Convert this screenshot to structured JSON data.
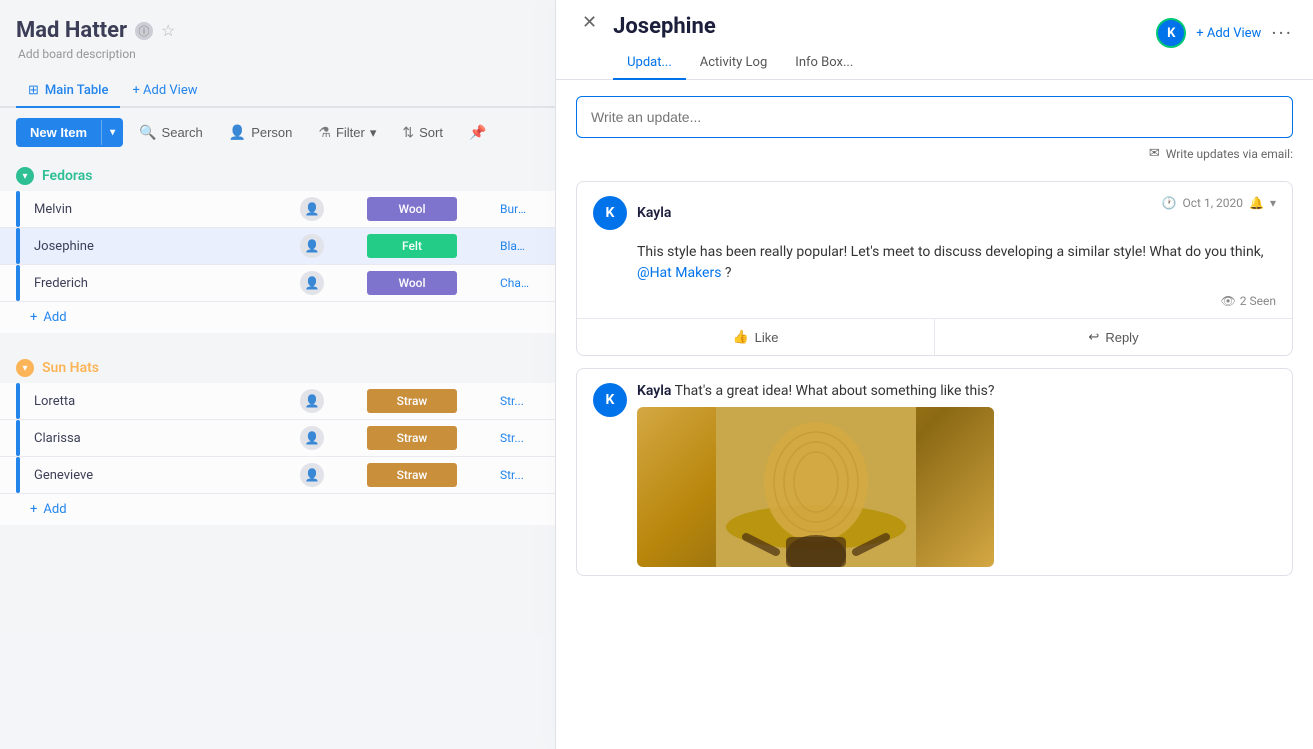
{
  "board": {
    "title": "Mad Hatter",
    "description": "Add board description",
    "view_tab": "Main Table",
    "add_view": "+ Add View"
  },
  "toolbar": {
    "new_item": "New Item",
    "search": "Search",
    "person": "Person",
    "filter": "Filter",
    "sort": "Sort"
  },
  "groups": [
    {
      "id": "fedoras",
      "name": "Fedoras",
      "color": "teal",
      "items": [
        {
          "name": "Melvin",
          "material": "Wool",
          "mat_class": "mat-wool",
          "color": "Burgu..."
        },
        {
          "name": "Josephine",
          "material": "Felt",
          "mat_class": "mat-felt",
          "color": "Black..."
        },
        {
          "name": "Frederich",
          "material": "Wool",
          "mat_class": "mat-wool",
          "color": "Charcoal..."
        }
      ]
    },
    {
      "id": "sun-hats",
      "name": "Sun Hats",
      "color": "orange",
      "items": [
        {
          "name": "Loretta",
          "material": "Straw",
          "mat_class": "mat-straw",
          "color": "Str..."
        },
        {
          "name": "Clarissa",
          "material": "Straw",
          "mat_class": "mat-straw",
          "color": "Str..."
        },
        {
          "name": "Genevieve",
          "material": "Straw",
          "mat_class": "mat-straw",
          "color": "Str..."
        }
      ]
    }
  ],
  "panel": {
    "title": "Josephine",
    "tabs": [
      "Updat...",
      "Activity Log",
      "Info Box..."
    ],
    "active_tab": "Updat...",
    "add_view": "+ Add View",
    "input_placeholder": "Write an update...",
    "email_update": "Write updates via email:",
    "comment": {
      "author": "Kayla",
      "avatar": "K",
      "date": "Oct 1, 2020",
      "body": "This style has been really popular! Let's meet to discuss developing a similar style! What do you think,",
      "mention": "@Hat Makers",
      "mention_suffix": " ?",
      "seen_count": "2 Seen",
      "like_label": "Like",
      "reply_label": "Reply"
    },
    "comment2": {
      "author": "Kayla",
      "avatar": "K",
      "text": "That's a great idea! What about something like this?"
    }
  },
  "icons": {
    "close": "✕",
    "star": "☆",
    "info": "ⓘ",
    "chevron_down": "▾",
    "clock": "🕐",
    "bell": "🔔",
    "eye": "👁",
    "thumb_up": "👍",
    "reply": "↩",
    "mail": "✉",
    "table": "⊞",
    "search": "🔍",
    "person": "👤",
    "filter": "⚗",
    "sort": "⇅",
    "pin": "📌"
  }
}
